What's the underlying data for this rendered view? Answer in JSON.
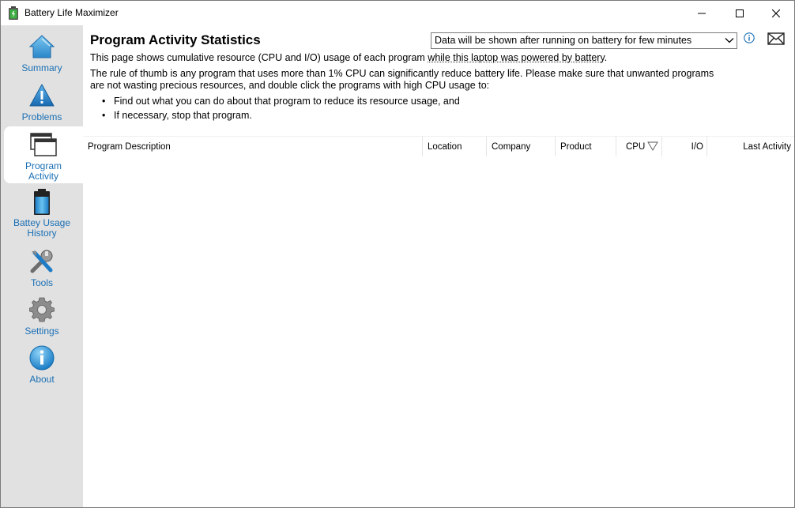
{
  "window": {
    "title": "Battery Life Maximizer"
  },
  "sidebar": {
    "items": [
      {
        "label": "Summary",
        "icon": "home-icon"
      },
      {
        "label": "Problems",
        "icon": "warning-icon"
      },
      {
        "label": "Program Activity",
        "icon": "windows-icon",
        "active": true
      },
      {
        "label": "Battey Usage History",
        "icon": "battery-icon"
      },
      {
        "label": "Tools",
        "icon": "tools-icon"
      },
      {
        "label": "Settings",
        "icon": "gear-icon"
      },
      {
        "label": "About",
        "icon": "info-icon"
      }
    ]
  },
  "main": {
    "title": "Program Activity Statistics",
    "period_select": {
      "value": "Data will be shown after running on battery for few minutes"
    },
    "description_prefix": "This page shows cumulative resource (CPU and I/O) usage of each program ",
    "description_link": "while this laptop was powered by battery",
    "description_suffix": ".",
    "rule_line1": "The rule of thumb is any program that uses more than 1% CPU can significantly reduce battery life. Please make sure that unwanted programs",
    "rule_line2": "are not wasting precious resources, and double click the programs with high CPU usage to:",
    "bullets": [
      "Find out what you can do about that program to reduce its resource usage, and",
      "If necessary, stop that program."
    ],
    "table": {
      "columns": [
        "Program Description",
        "Location",
        "Company",
        "Product",
        "CPU",
        "I/O",
        "Last Activity"
      ],
      "rows": []
    }
  },
  "colors": {
    "sidebar_bg": "#e1e1e1",
    "nav_label": "#1a6fb5",
    "accent": "#1a8fd8"
  }
}
